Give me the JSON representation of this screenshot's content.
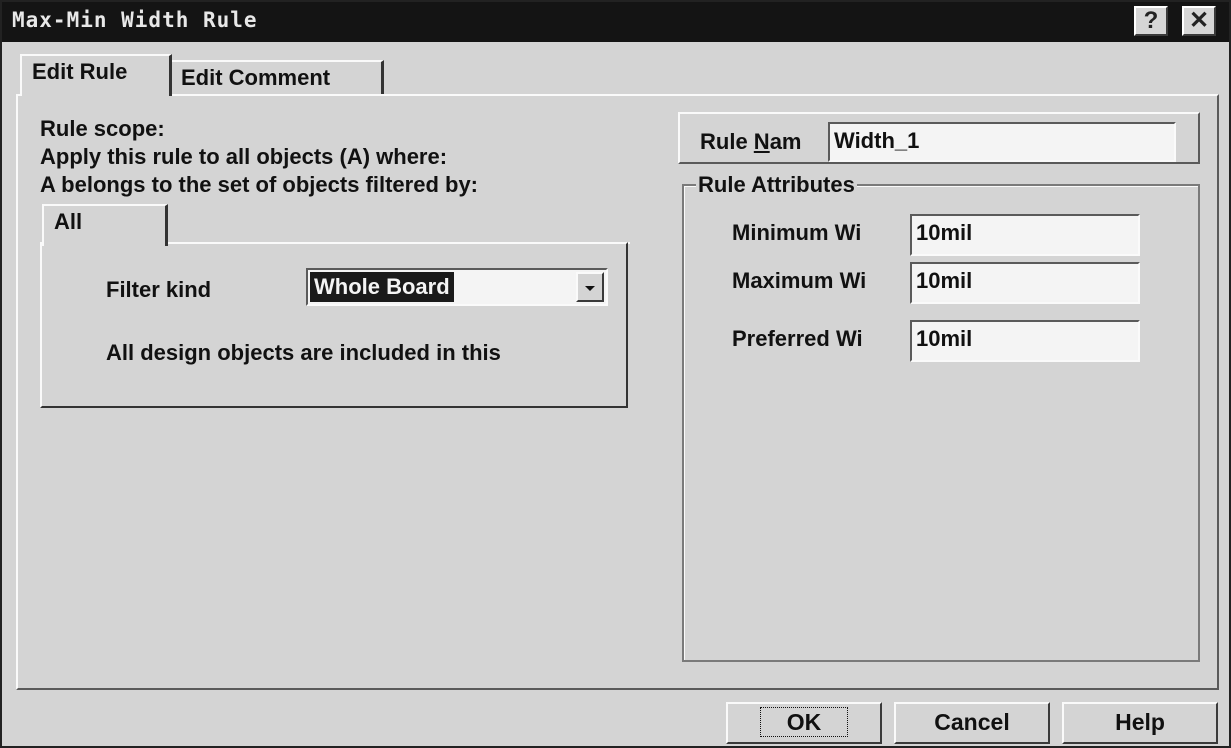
{
  "window": {
    "title": "Max-Min Width Rule",
    "help_icon": "question-mark",
    "close_icon": "x-mark"
  },
  "tabs": [
    {
      "label": "Edit Rule"
    },
    {
      "label": "Edit Comment"
    }
  ],
  "scope": {
    "line1": "Rule scope:",
    "line2": "Apply this rule to all objects (A) where:",
    "line3": "A belongs to the set of objects filtered by:",
    "filter_tab": "All",
    "filter_kind_label": "Filter kind",
    "filter_kind_value": "Whole Board",
    "dropdown_icon": "chevron-down",
    "description": "All design objects are included in this"
  },
  "rule_name": {
    "label_prefix": "Rule ",
    "label_underlined": "N",
    "label_suffix": "am",
    "value": "Width_1"
  },
  "attributes": {
    "group_label": "Rule Attributes",
    "fields": [
      {
        "label": "Minimum Wi",
        "value": "10mil"
      },
      {
        "label": "Maximum Wi",
        "value": "10mil"
      },
      {
        "label": "Preferred Wi",
        "value": "10mil"
      }
    ]
  },
  "buttons": {
    "ok": "OK",
    "cancel": "Cancel",
    "help": "Help"
  }
}
